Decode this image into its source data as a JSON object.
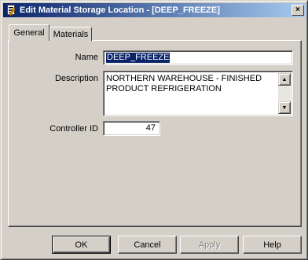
{
  "window": {
    "title": "Edit Material Storage Location - [DEEP_FREEZE]",
    "title_icon": "edit-document-icon",
    "close_glyph": "×"
  },
  "tabs": [
    {
      "label": "General",
      "active": true
    },
    {
      "label": "Materials",
      "active": false
    }
  ],
  "form": {
    "name_label": "Name",
    "name_value": "DEEP_FREEZE",
    "description_label": "Description",
    "description_value": "NORTHERN WAREHOUSE - FINISHED\nPRODUCT REFRIGERATION",
    "controller_id_label": "Controller ID",
    "controller_id_value": "47"
  },
  "buttons": {
    "ok": "OK",
    "cancel": "Cancel",
    "apply": "Apply",
    "help": "Help"
  },
  "colors": {
    "titlebar_start": "#0a246a",
    "titlebar_end": "#a6caf0",
    "face": "#d4d0c8",
    "selection": "#0a246a"
  }
}
